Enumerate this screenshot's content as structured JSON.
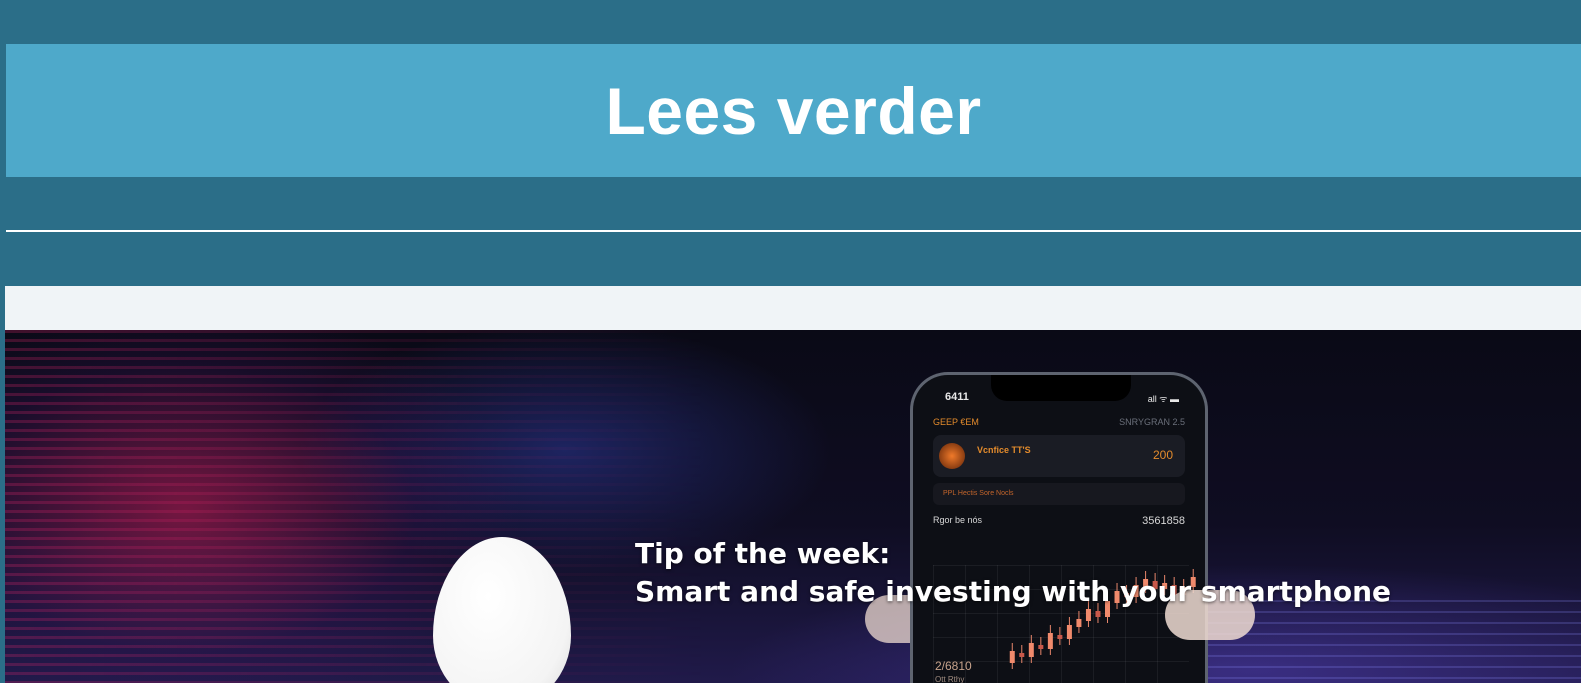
{
  "cta": {
    "label": "Lees verder"
  },
  "hero": {
    "headline_line1": "Tip of the week:",
    "headline_line2": "Smart and safe investing with your smartphone",
    "phone": {
      "time": "6411",
      "status": "all ᯤ ▬",
      "header_left": "GEEP  €EM",
      "header_right": "SNRYGRAN 2.5",
      "coin_title": "Vcnfice TT'S",
      "coin_value": "200",
      "alert_text": "PPL Hectis Sore Nocls",
      "balance_label": "Rgor be nós",
      "balance_value": "3561858",
      "price": "2/6810",
      "price_sub": "Ott Rthy"
    },
    "candles": [
      {
        "o": 20,
        "c": 32
      },
      {
        "o": 30,
        "c": 26
      },
      {
        "o": 26,
        "c": 40
      },
      {
        "o": 38,
        "c": 34
      },
      {
        "o": 34,
        "c": 50
      },
      {
        "o": 48,
        "c": 44
      },
      {
        "o": 44,
        "c": 58
      },
      {
        "o": 56,
        "c": 64
      },
      {
        "o": 62,
        "c": 74
      },
      {
        "o": 72,
        "c": 66
      },
      {
        "o": 66,
        "c": 82
      },
      {
        "o": 80,
        "c": 92
      },
      {
        "o": 90,
        "c": 86
      },
      {
        "o": 86,
        "c": 98
      },
      {
        "o": 96,
        "c": 104
      },
      {
        "o": 102,
        "c": 94
      },
      {
        "o": 94,
        "c": 100
      },
      {
        "o": 98,
        "c": 88
      },
      {
        "o": 88,
        "c": 96
      },
      {
        "o": 96,
        "c": 106
      }
    ]
  }
}
